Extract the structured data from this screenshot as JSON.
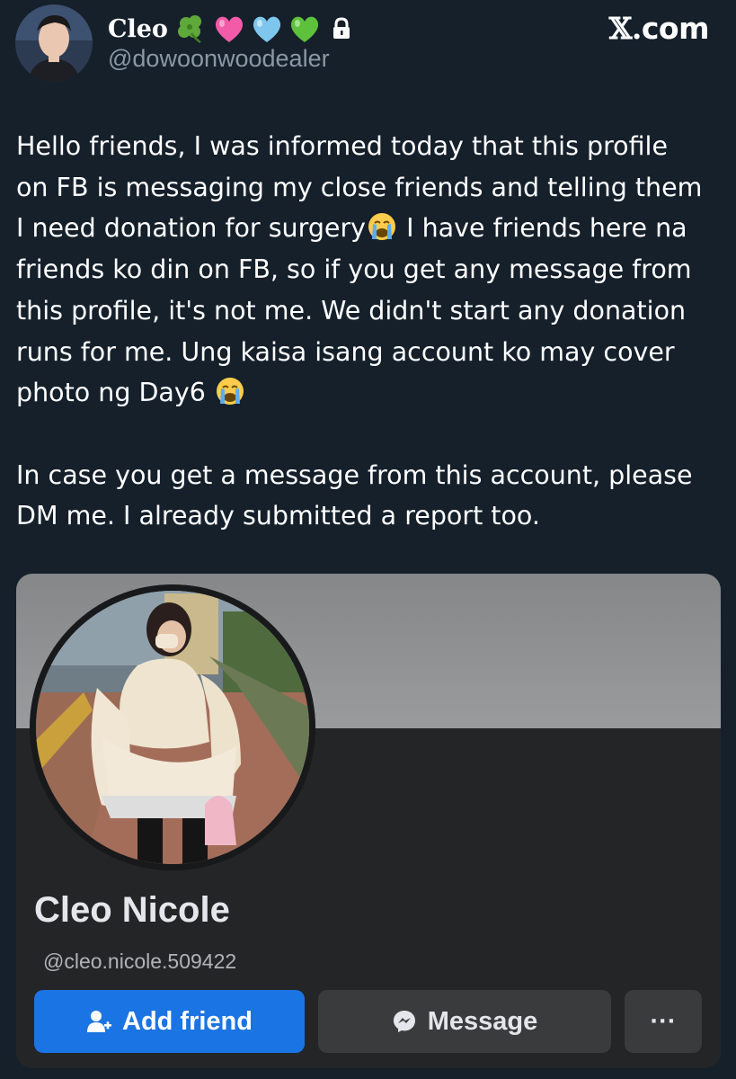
{
  "tweet": {
    "author": {
      "display_name": "Cleo",
      "name_emojis": [
        "four-leaf-clover-icon",
        "pink-heart-icon",
        "light-blue-heart-icon",
        "green-heart-icon"
      ],
      "protected_icon": "lock-icon",
      "handle": "@dowoonwoodealer"
    },
    "brand": "com",
    "brand_mark": "𝕏.",
    "text_lines": [
      "Hello friends, I was informed today that this profile",
      "on FB is messaging my close friends and telling them",
      "I need donation for surgery",
      " I have friends here na",
      "friends ko din on FB, so if you get any message from",
      "this profile, it's not me. We didn't start any donation",
      "runs for me. Ung kaisa isang account ko may cover",
      "photo ng Day6 "
    ],
    "text_para2_lines": [
      "In case you get a message from this account, please",
      "DM me. I already submitted a report too."
    ],
    "emoji": "loudly-crying-face-icon"
  },
  "fb_profile": {
    "name": "Cleo Nicole",
    "handle": "@cleo.nicole.509422",
    "add_friend_label": "Add friend",
    "message_label": "Message",
    "more_label": "···",
    "colors": {
      "add_friend_bg": "#1b74e4",
      "button_bg": "#3a3b3c",
      "card_bg": "#242526"
    }
  }
}
